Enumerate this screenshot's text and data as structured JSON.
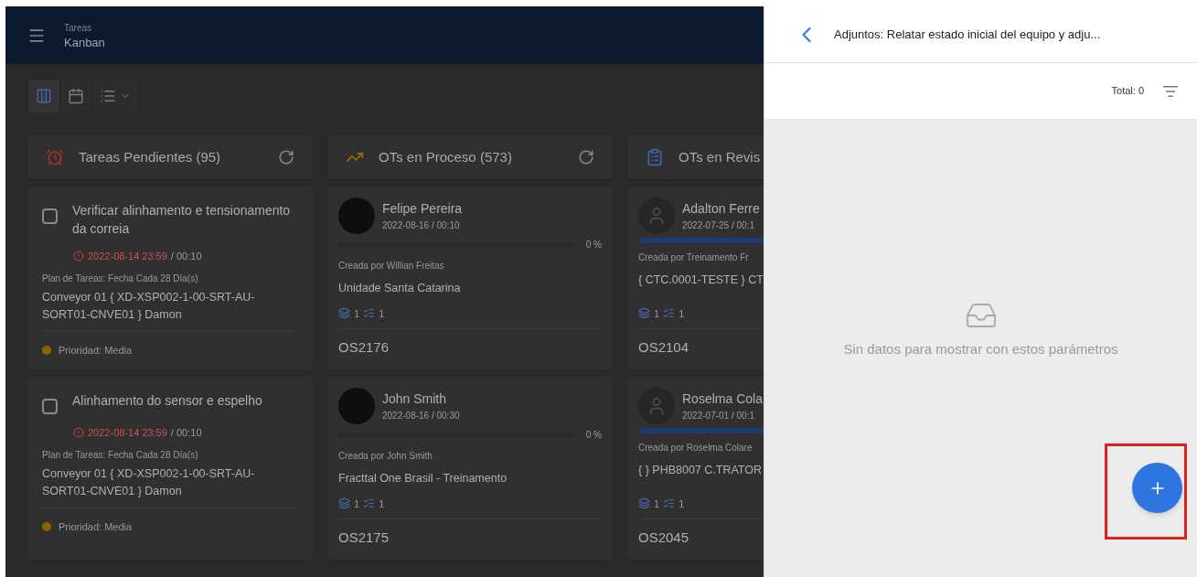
{
  "header": {
    "section": "Tareas",
    "title": "Kanban"
  },
  "view_buttons": [
    {
      "kind": "board",
      "selected": true
    },
    {
      "kind": "calendar",
      "selected": false
    },
    {
      "kind": "list",
      "selected": false
    }
  ],
  "columns": [
    {
      "kind": "pending",
      "title": "Tareas Pendientes (95)",
      "refresh": true,
      "cards": [
        {
          "kind": "task",
          "checked": false,
          "title": "Verificar alinhamento e tensionamento da correia",
          "due": "2022-08-14 23:59",
          "duration": "/ 00:10",
          "plan": "Plan de Tareas: Fecha Cada 28 Día(s)",
          "asset": "Conveyor 01 { XD-XSP002-1-00-SRT-AU-SORT01-CNVE01 } Damon",
          "priority": "Prioridad: Media",
          "color": "#8a6400"
        },
        {
          "kind": "task",
          "checked": false,
          "title": "Alinhamento do sensor e espelho",
          "due": "2022-08-14 23:59",
          "duration": "/ 00:10",
          "plan": "Plan de Tareas: Fecha Cada 28 Día(s)",
          "asset": "Conveyor 01 { XD-XSP002-1-00-SRT-AU-SORT01-CNVE01 } Damon",
          "priority": "Prioridad: Media",
          "color": "#8a6400"
        }
      ]
    },
    {
      "kind": "process",
      "title": "OTs en Proceso (573)",
      "refresh": true,
      "cards": [
        {
          "kind": "order",
          "avatar": {
            "kind": "photo"
          },
          "name": "Felipe Pereira",
          "date": "2022-08-16 / 00:10",
          "level": 0,
          "percent": "0 %",
          "created_by": "Creada por Willian Freitas",
          "location": "Unidade Santa Catarina",
          "tasks": "1",
          "items": "1",
          "code": "OS2176"
        },
        {
          "kind": "order",
          "avatar": {
            "kind": "photo"
          },
          "name": "John Smith",
          "date": "2022-08-16 / 00:30",
          "level": 0,
          "percent": "0 %",
          "created_by": "Creada por John Smith",
          "location": "Fracttal One Brasil - Treinamento",
          "tasks": "1",
          "items": "1",
          "code": "OS2175"
        }
      ]
    },
    {
      "kind": "review",
      "title": "OTs en Revis",
      "refresh": false,
      "cards": [
        {
          "kind": "order",
          "avatar": {
            "kind": "generic"
          },
          "name": "Adalton Ferre",
          "date": "2022-07-25 / 00:1",
          "level": 1,
          "created_by": "Creada por Treinamento Fr",
          "location": "{ CTC.0001-TESTE } CT",
          "tasks": "1",
          "items": "1",
          "code": "OS2104"
        },
        {
          "kind": "order",
          "avatar": {
            "kind": "generic"
          },
          "name": "Roselma Cola",
          "date": "2022-07-01 / 00:1",
          "level": 1,
          "created_by": "Creada por Roselma Colare",
          "location": "{ } PHB8007 C.TRATOR",
          "tasks": "1",
          "items": "1",
          "code": "OS2045"
        }
      ]
    }
  ],
  "panel": {
    "title": "Adjuntos: Relatar estado inicial del equipo y adju...",
    "total": "Total: 0",
    "empty_message": "Sin datos para mostrar con estos parámetros",
    "highlighted_add": true
  }
}
